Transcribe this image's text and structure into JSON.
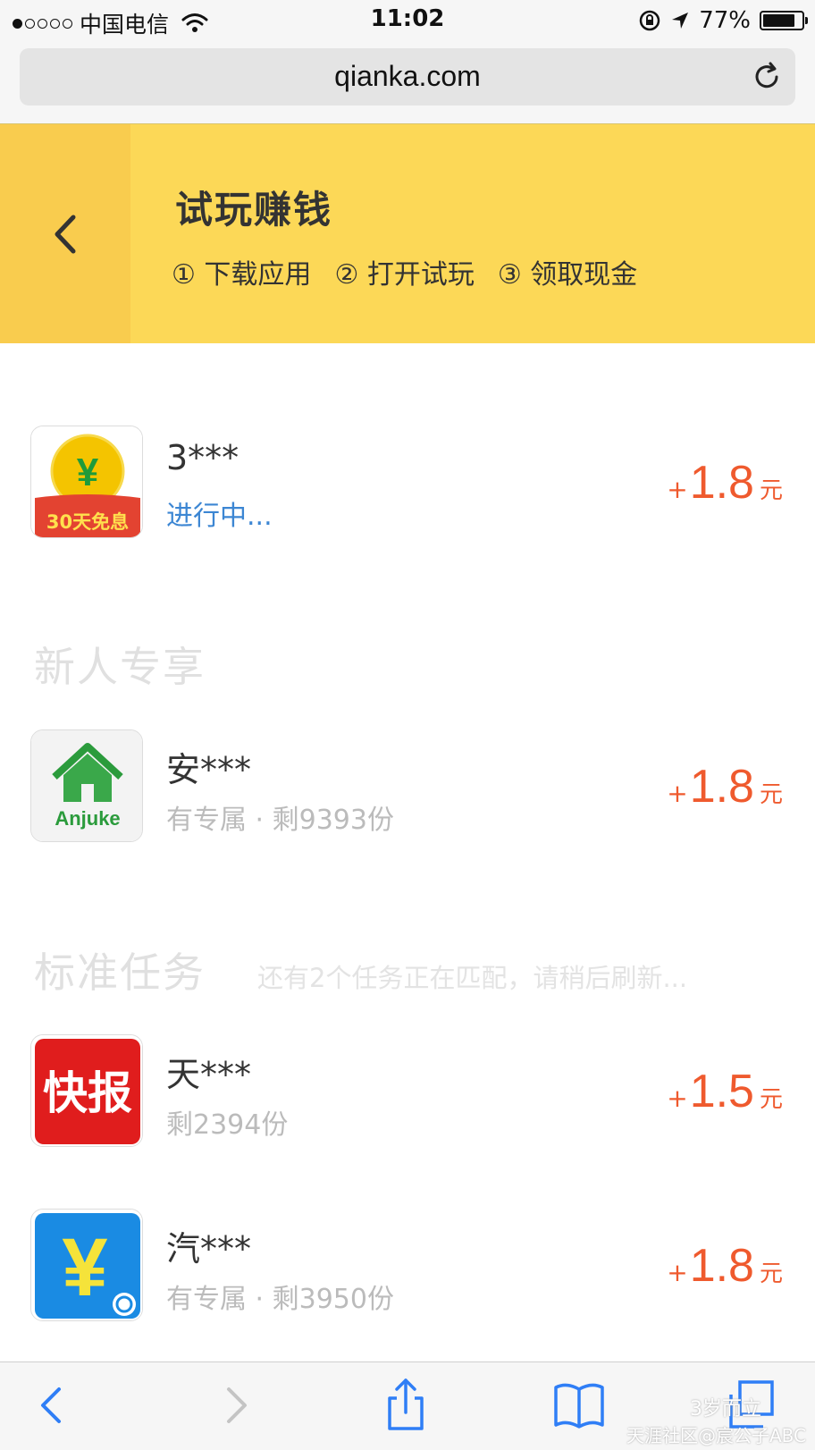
{
  "status_bar": {
    "carrier": "中国电信",
    "time": "11:02",
    "battery": "77%"
  },
  "browser": {
    "url": "qianka.com"
  },
  "header": {
    "title": "试玩赚钱",
    "steps": [
      "① 下载应用",
      "② 打开试玩",
      "③ 领取现金"
    ]
  },
  "current_task": {
    "name": "3***",
    "status": "进行中...",
    "icon_label": "30天免息",
    "icon_symbol": "¥",
    "reward_plus": "+",
    "reward": "1.8",
    "unit": "元"
  },
  "new_user_section": {
    "title": "新人专享",
    "items": [
      {
        "name": "安***",
        "sub": "有专属 · 剩9393份",
        "icon_label": "Anjuke",
        "reward_plus": "+",
        "reward": "1.8",
        "unit": "元"
      }
    ]
  },
  "standard_section": {
    "title": "标准任务",
    "note": "还有2个任务正在匹配，请稍后刷新...",
    "items": [
      {
        "name": "天***",
        "sub": "剩2394份",
        "icon_label": "快报",
        "reward_plus": "+",
        "reward": "1.5",
        "unit": "元"
      },
      {
        "name": "汽***",
        "sub": "有专属 · 剩3950份",
        "icon_symbol": "¥",
        "reward_plus": "+",
        "reward": "1.8",
        "unit": "元"
      }
    ]
  },
  "watermark": {
    "line1": "3岁而立",
    "line2": "天涯社区@宸公子ABC"
  },
  "colors": {
    "header_bg": "#fcd857",
    "back_zone_bg": "#f9cc4e",
    "reward": "#ef5a2e",
    "status_active": "#3c86d3",
    "toolbar_icon": "#2f7ef6"
  }
}
